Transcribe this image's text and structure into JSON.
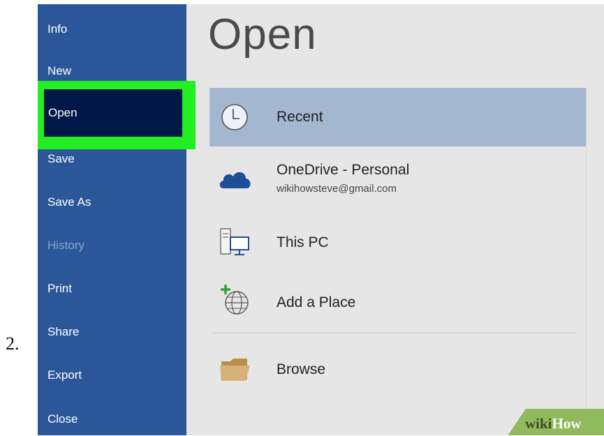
{
  "step_label": "2.",
  "sidebar": {
    "items": [
      {
        "label": "Info"
      },
      {
        "label": "New"
      },
      {
        "label": "Open"
      },
      {
        "label": "Save"
      },
      {
        "label": "Save As"
      },
      {
        "label": "History"
      },
      {
        "label": "Print"
      },
      {
        "label": "Share"
      },
      {
        "label": "Export"
      },
      {
        "label": "Close"
      }
    ]
  },
  "main": {
    "title": "Open",
    "locations": [
      {
        "label": "Recent",
        "icon": "clock-icon"
      },
      {
        "label": "OneDrive - Personal",
        "sublabel": "wikihowsteve@gmail.com",
        "icon": "cloud-icon"
      },
      {
        "label": "This PC",
        "icon": "computer-icon"
      },
      {
        "label": "Add a Place",
        "icon": "add-place-globe-icon"
      },
      {
        "label": "Browse",
        "icon": "folder-icon"
      }
    ]
  },
  "watermark": {
    "wiki": "wiki",
    "how": "How"
  },
  "colors": {
    "sidebar": "#2b579a",
    "selected_item": "#001848",
    "highlight_box": "#22ee22",
    "recent_row": "#a4b7d1",
    "background": "#e6e6e6",
    "onedrive_cloud": "#1f4e98",
    "folder": "#c9a567"
  }
}
